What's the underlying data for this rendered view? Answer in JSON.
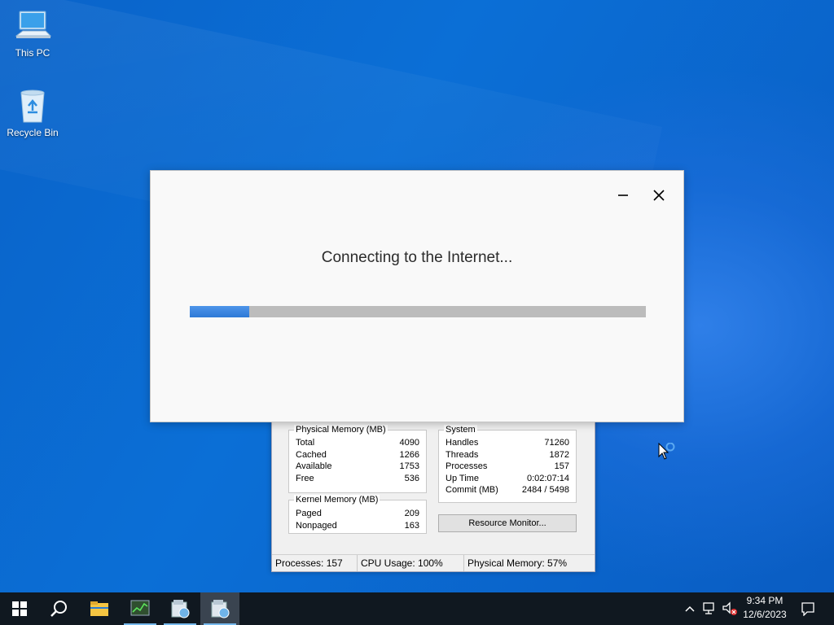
{
  "desktop": {
    "icons": [
      {
        "label": "This PC",
        "icon": "computer-icon"
      },
      {
        "label": "Recycle Bin",
        "icon": "recycle-bin-icon"
      }
    ]
  },
  "dialog": {
    "title": "Connecting to the Internet...",
    "progress_percent": 13,
    "accent": "#3d88e2"
  },
  "task_manager": {
    "physical_memory": {
      "title": "Physical Memory (MB)",
      "rows": [
        {
          "label": "Total",
          "value": "4090"
        },
        {
          "label": "Cached",
          "value": "1266"
        },
        {
          "label": "Available",
          "value": "1753"
        },
        {
          "label": "Free",
          "value": "536"
        }
      ]
    },
    "kernel_memory": {
      "title": "Kernel Memory (MB)",
      "rows": [
        {
          "label": "Paged",
          "value": "209"
        },
        {
          "label": "Nonpaged",
          "value": "163"
        }
      ]
    },
    "system": {
      "title": "System",
      "rows": [
        {
          "label": "Handles",
          "value": "71260"
        },
        {
          "label": "Threads",
          "value": "1872"
        },
        {
          "label": "Processes",
          "value": "157"
        },
        {
          "label": "Up Time",
          "value": "0:02:07:14"
        },
        {
          "label": "Commit (MB)",
          "value": "2484 / 5498"
        }
      ]
    },
    "resource_monitor_label": "Resource Monitor...",
    "status": {
      "processes": "Processes: 157",
      "cpu": "CPU Usage: 100%",
      "memory": "Physical Memory: 57%"
    }
  },
  "taskbar": {
    "items": [
      "start-icon",
      "search-icon",
      "file-explorer-icon",
      "task-manager-icon",
      "setup-icon",
      "setup-icon"
    ],
    "clock": {
      "time": "9:34 PM",
      "date": "12/6/2023"
    }
  },
  "colors": {
    "taskbar": "#101820",
    "desktop": "#0a63c9"
  }
}
